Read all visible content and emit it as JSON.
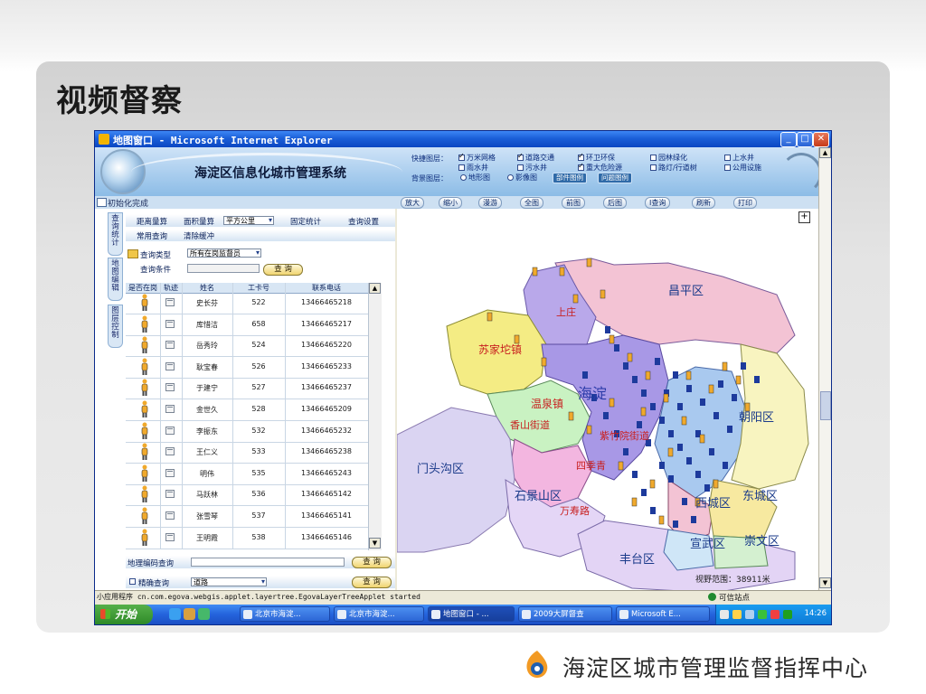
{
  "slide": {
    "title": "视频督察",
    "org_name": "海淀区城市管理监督指挥中心"
  },
  "ie": {
    "title": "地图窗口 - Microsoft Internet Explorer",
    "status_left": "小应用程序 cn.com.egova.webgis.applet.layertree.EgovaLayerTreeApplet started",
    "status_trusted": "可信站点"
  },
  "app": {
    "system_title": "海淀区信息化城市管理系统",
    "quick_layers_label": "快捷图层：",
    "layers": [
      {
        "label": "万米网格",
        "checked": true
      },
      {
        "label": "道路交通",
        "checked": true
      },
      {
        "label": "环卫环保",
        "checked": true
      },
      {
        "label": "园林绿化",
        "checked": false
      },
      {
        "label": "上水井",
        "checked": false
      },
      {
        "label": "雨水井",
        "checked": false
      },
      {
        "label": "污水井",
        "checked": false
      },
      {
        "label": "重大危险源",
        "checked": true
      },
      {
        "label": "路灯/行道树",
        "checked": false
      },
      {
        "label": "公用设施",
        "checked": false
      }
    ],
    "bg_layer_label": "背景图层：",
    "bg_options": [
      "地形图",
      "影像图"
    ],
    "legend_buttons": [
      "部件图例",
      "问题图例"
    ],
    "init_status": "初始化完成",
    "toolbar": [
      "放大",
      "缩小",
      "漫游",
      "全图",
      "前图",
      "后图",
      "I查询",
      "刷新",
      "打印"
    ]
  },
  "left": {
    "vertical_tabs": [
      "查询统计",
      "地图编辑",
      "图层控制"
    ],
    "row1": {
      "distance": "距离量算",
      "area": "面积量算",
      "unit": "平方公里",
      "fixed_stats": "固定统计",
      "query_settings": "查询设置"
    },
    "row2": {
      "common_query": "常用查询",
      "clear_buffer": "清除缓冲"
    },
    "query_type_label": "查询类型",
    "query_type_value": "所有在岗监督员",
    "query_condition_label": "查询条件",
    "query_button": "查 询",
    "table_headers": [
      "是否在岗",
      "轨迹",
      "姓名",
      "工卡号",
      "联系电话"
    ],
    "rows": [
      {
        "name": "史长芬",
        "card": "522",
        "phone": "13466465218"
      },
      {
        "name": "库惜洁",
        "card": "658",
        "phone": "13466465217"
      },
      {
        "name": "岳秀玲",
        "card": "524",
        "phone": "13466465220"
      },
      {
        "name": "耿宝春",
        "card": "526",
        "phone": "13466465233"
      },
      {
        "name": "于建宁",
        "card": "527",
        "phone": "13466465237"
      },
      {
        "name": "金世久",
        "card": "528",
        "phone": "13466465209"
      },
      {
        "name": "李振东",
        "card": "532",
        "phone": "13466465232"
      },
      {
        "name": "王仁义",
        "card": "533",
        "phone": "13466465238"
      },
      {
        "name": "明伟",
        "card": "535",
        "phone": "13466465243"
      },
      {
        "name": "马跃林",
        "card": "536",
        "phone": "13466465142"
      },
      {
        "name": "张雪琴",
        "card": "537",
        "phone": "13466465141"
      },
      {
        "name": "王明霞",
        "card": "538",
        "phone": "13466465146"
      }
    ],
    "geocode_label": "地理编码查询",
    "geocode_button": "查 询",
    "exact_label": "精确查询",
    "exact_value": "道路",
    "exact_button": "查 询"
  },
  "map": {
    "districts": [
      "昌平区",
      "朝阳区",
      "门头沟区",
      "石景山区",
      "西城区",
      "东城区",
      "宣武区",
      "崇文区",
      "丰台区"
    ],
    "streets": [
      "苏家坨镇",
      "温泉镇",
      "香山街道",
      "海淀",
      "上庄",
      "紫竹院街道",
      "四季青",
      "万寿路"
    ],
    "scale_text": "视野范围：38911米"
  },
  "taskbar": {
    "start": "开始",
    "tasks": [
      "北京市海淀...",
      "北京市海淀...",
      "地图窗口 - ...",
      "2009大屏督查",
      "Microsoft E..."
    ],
    "clock": "14:26"
  },
  "colors": {
    "district_changping": "#f3c3d4",
    "district_haidian_purple": "#b9a8ea",
    "district_yellow": "#f4ec84",
    "district_green": "#c9f2c2",
    "district_blue": "#a9c9ef",
    "district_mentougou": "#dad4f2",
    "marker_blue": "#1d3a9c",
    "marker_orange": "#f0a92c"
  }
}
